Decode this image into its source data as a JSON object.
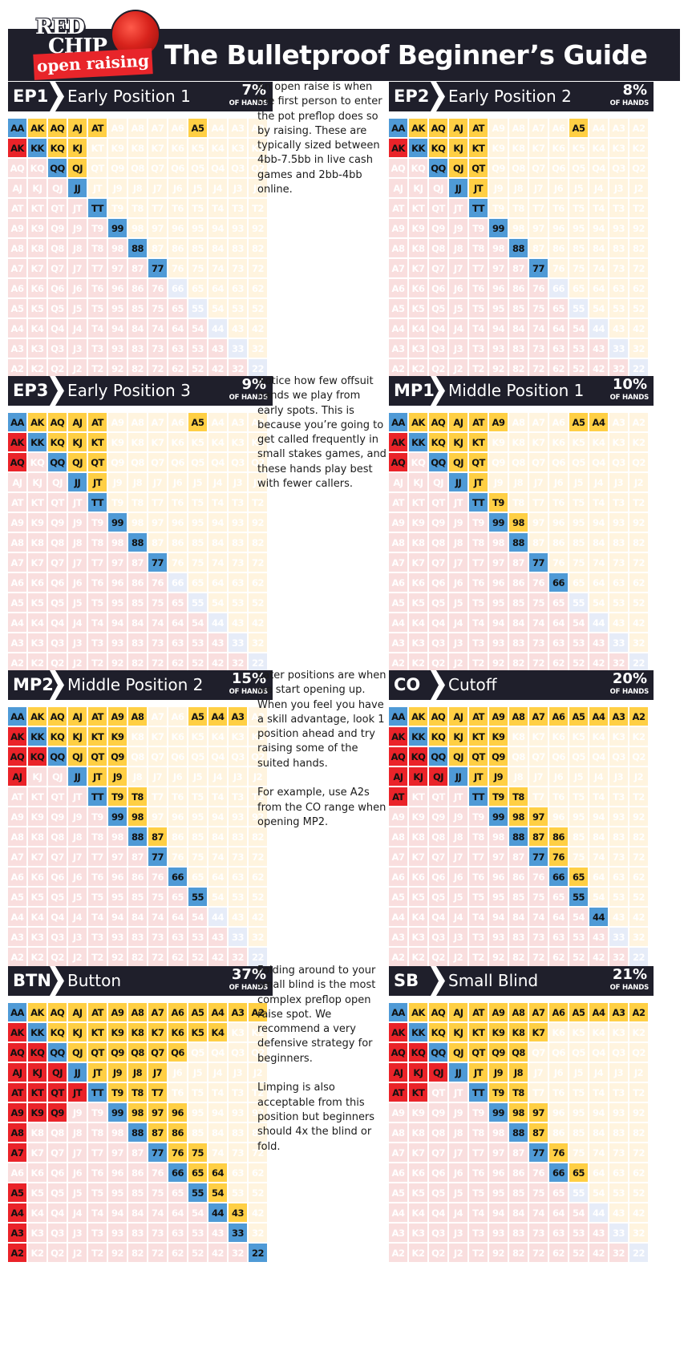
{
  "header": {
    "title": "The Bulletproof Beginner’s Guide",
    "logo": {
      "line1": "RED",
      "line2": "CHIP",
      "banner": "open raising"
    }
  },
  "ranks": [
    "A",
    "K",
    "Q",
    "J",
    "T",
    "9",
    "8",
    "7",
    "6",
    "5",
    "4",
    "3",
    "2"
  ],
  "legend_colors": {
    "pair": "#4f9ad6",
    "suited": "#ffcf44",
    "offsuit": "#ea2329",
    "fold_suited": "#fff4df",
    "fold_offsuit": "#f9dede",
    "fold_pair": "#e6ecf8",
    "header_bg": "#1f1f2b"
  },
  "panels": [
    {
      "code": "EP1",
      "name": "Early Position 1",
      "pct": "7%",
      "pct_label": "OF HANDS",
      "hands": [
        "AA",
        "KK",
        "QQ",
        "JJ",
        "TT",
        "99",
        "88",
        "77",
        "AKs",
        "AQs",
        "AJs",
        "ATs",
        "A5s",
        "KQs",
        "KJs",
        "QJs",
        "AKo"
      ]
    },
    {
      "code": "EP2",
      "name": "Early Position 2",
      "pct": "8%",
      "pct_label": "OF HANDS",
      "hands": [
        "AA",
        "KK",
        "QQ",
        "JJ",
        "TT",
        "99",
        "88",
        "77",
        "AKs",
        "AQs",
        "AJs",
        "ATs",
        "A5s",
        "KQs",
        "KJs",
        "KTs",
        "QJs",
        "QTs",
        "JTs",
        "AKo"
      ]
    },
    {
      "code": "EP3",
      "name": "Early Position 3",
      "pct": "9%",
      "pct_label": "OF HANDS",
      "hands": [
        "AA",
        "KK",
        "QQ",
        "JJ",
        "TT",
        "99",
        "88",
        "77",
        "AKs",
        "AQs",
        "AJs",
        "ATs",
        "A5s",
        "KQs",
        "KJs",
        "KTs",
        "QJs",
        "QTs",
        "JTs",
        "AKo",
        "AQo"
      ]
    },
    {
      "code": "MP1",
      "name": "Middle Position 1",
      "pct": "10%",
      "pct_label": "OF HANDS",
      "hands": [
        "AA",
        "KK",
        "QQ",
        "JJ",
        "TT",
        "99",
        "88",
        "77",
        "66",
        "AKs",
        "AQs",
        "AJs",
        "ATs",
        "A9s",
        "A5s",
        "A4s",
        "KQs",
        "KJs",
        "KTs",
        "QJs",
        "QTs",
        "JTs",
        "T9s",
        "98s",
        "AKo",
        "AQo"
      ]
    },
    {
      "code": "MP2",
      "name": "Middle Position 2",
      "pct": "15%",
      "pct_label": "OF HANDS",
      "hands": [
        "AA",
        "KK",
        "QQ",
        "JJ",
        "TT",
        "99",
        "88",
        "77",
        "66",
        "55",
        "AKs",
        "AQs",
        "AJs",
        "ATs",
        "A9s",
        "A8s",
        "A5s",
        "A4s",
        "A3s",
        "KQs",
        "KJs",
        "KTs",
        "K9s",
        "QJs",
        "QTs",
        "Q9s",
        "JTs",
        "J9s",
        "T9s",
        "T8s",
        "98s",
        "87s",
        "AKo",
        "AQo",
        "AJo",
        "KQo"
      ]
    },
    {
      "code": "CO",
      "name": "Cutoff",
      "pct": "20%",
      "pct_label": "OF HANDS",
      "hands": [
        "AA",
        "KK",
        "QQ",
        "JJ",
        "TT",
        "99",
        "88",
        "77",
        "66",
        "55",
        "44",
        "AKs",
        "AQs",
        "AJs",
        "ATs",
        "A9s",
        "A8s",
        "A7s",
        "A6s",
        "A5s",
        "A4s",
        "A3s",
        "A2s",
        "KQs",
        "KJs",
        "KTs",
        "K9s",
        "QJs",
        "QTs",
        "Q9s",
        "JTs",
        "J9s",
        "T9s",
        "T8s",
        "98s",
        "97s",
        "87s",
        "86s",
        "76s",
        "65s",
        "AKo",
        "AQo",
        "AJo",
        "ATo",
        "KQo",
        "KJo",
        "QJo"
      ]
    },
    {
      "code": "BTN",
      "name": "Button",
      "pct": "37%",
      "pct_label": "OF HANDS",
      "hands": [
        "AA",
        "KK",
        "QQ",
        "JJ",
        "TT",
        "99",
        "88",
        "77",
        "66",
        "55",
        "44",
        "33",
        "22",
        "AKs",
        "AQs",
        "AJs",
        "ATs",
        "A9s",
        "A8s",
        "A7s",
        "A6s",
        "A5s",
        "A4s",
        "A3s",
        "A2s",
        "KQs",
        "KJs",
        "KTs",
        "K9s",
        "K8s",
        "K7s",
        "K6s",
        "K5s",
        "K4s",
        "QJs",
        "QTs",
        "Q9s",
        "Q8s",
        "Q7s",
        "Q6s",
        "JTs",
        "J9s",
        "J8s",
        "J7s",
        "T9s",
        "T8s",
        "T7s",
        "98s",
        "97s",
        "96s",
        "87s",
        "86s",
        "76s",
        "75s",
        "65s",
        "64s",
        "54s",
        "43s",
        "AKo",
        "AQo",
        "AJo",
        "ATo",
        "A9o",
        "A8o",
        "A7o",
        "A5o",
        "A4o",
        "A3o",
        "A2o",
        "KQo",
        "KJo",
        "KTo",
        "K9o",
        "QJo",
        "QTo",
        "Q9o",
        "JTo"
      ]
    },
    {
      "code": "SB",
      "name": "Small Blind",
      "pct": "21%",
      "pct_label": "OF HANDS",
      "hands": [
        "AA",
        "KK",
        "QQ",
        "JJ",
        "TT",
        "99",
        "88",
        "77",
        "66",
        "AKs",
        "AQs",
        "AJs",
        "ATs",
        "A9s",
        "A8s",
        "A7s",
        "A6s",
        "A5s",
        "A4s",
        "A3s",
        "A2s",
        "KQs",
        "KJs",
        "KTs",
        "K9s",
        "K8s",
        "K7s",
        "QJs",
        "QTs",
        "Q9s",
        "Q8s",
        "JTs",
        "J9s",
        "J8s",
        "T9s",
        "T8s",
        "98s",
        "97s",
        "87s",
        "76s",
        "65s",
        "AKo",
        "AQo",
        "AJo",
        "ATo",
        "KQo",
        "KJo",
        "KTo",
        "QJo"
      ]
    }
  ],
  "notes": [
    "An open raise is when the first person to enter the pot preflop does so by raising. These are typically sized between 4bb-7.5bb in live cash games and 2bb-4bb online.",
    "Notice how few offsuit hands we play from early spots. This is because you’re going to get called frequently in small stakes games, and these hands play best with fewer callers.",
    "Later positions are when we start opening up. When you feel you have a skill advantage, look 1 position ahead and try raising some of the suited hands.\n\nFor example, use A2s from the CO range when opening MP2.",
    "Folding around to your small blind is the most complex preflop open raise spot. We recommend a very defensive strategy for beginners.\n\nLimping is also acceptable from this position but beginners should 4x the blind or fold."
  ]
}
